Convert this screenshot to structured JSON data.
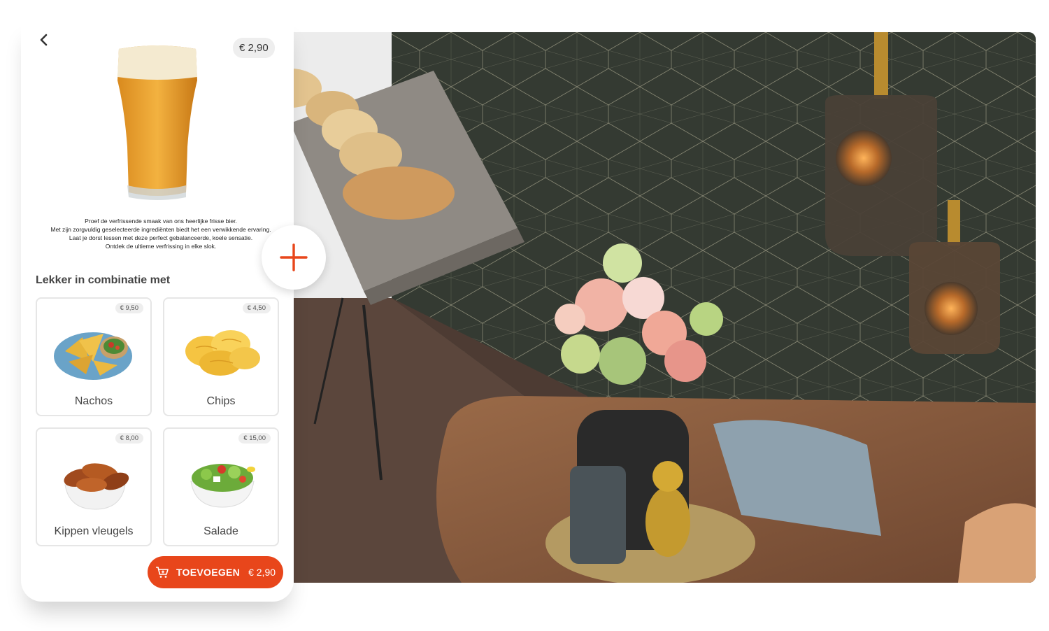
{
  "product": {
    "price": "€ 2,90",
    "description_lines": [
      "Proef de verfrissende smaak van ons heerlijke frisse bier.",
      "Met zijn zorgvuldig geselecteerde ingrediënten biedt het een verwikkende ervaring.",
      "Laat je dorst lessen met deze perfect gebalanceerde, koele sensatie.",
      "Ontdek de ultieme verfrissing in elke slok."
    ]
  },
  "combination": {
    "title": "Lekker in combinatie met",
    "items": [
      {
        "name": "Nachos",
        "price": "€ 9,50"
      },
      {
        "name": "Chips",
        "price": "€ 4,50"
      },
      {
        "name": "Kippen vleugels",
        "price": "€ 8,00"
      },
      {
        "name": "Salade",
        "price": "€ 15,00"
      }
    ]
  },
  "cart_button": {
    "label": "TOEVOEGEN",
    "amount": "€ 2,90"
  },
  "colors": {
    "accent": "#e8461b",
    "pill": "#eeeeee"
  },
  "icons": [
    "chevron-left-icon",
    "cart-icon",
    "plus-icon"
  ]
}
